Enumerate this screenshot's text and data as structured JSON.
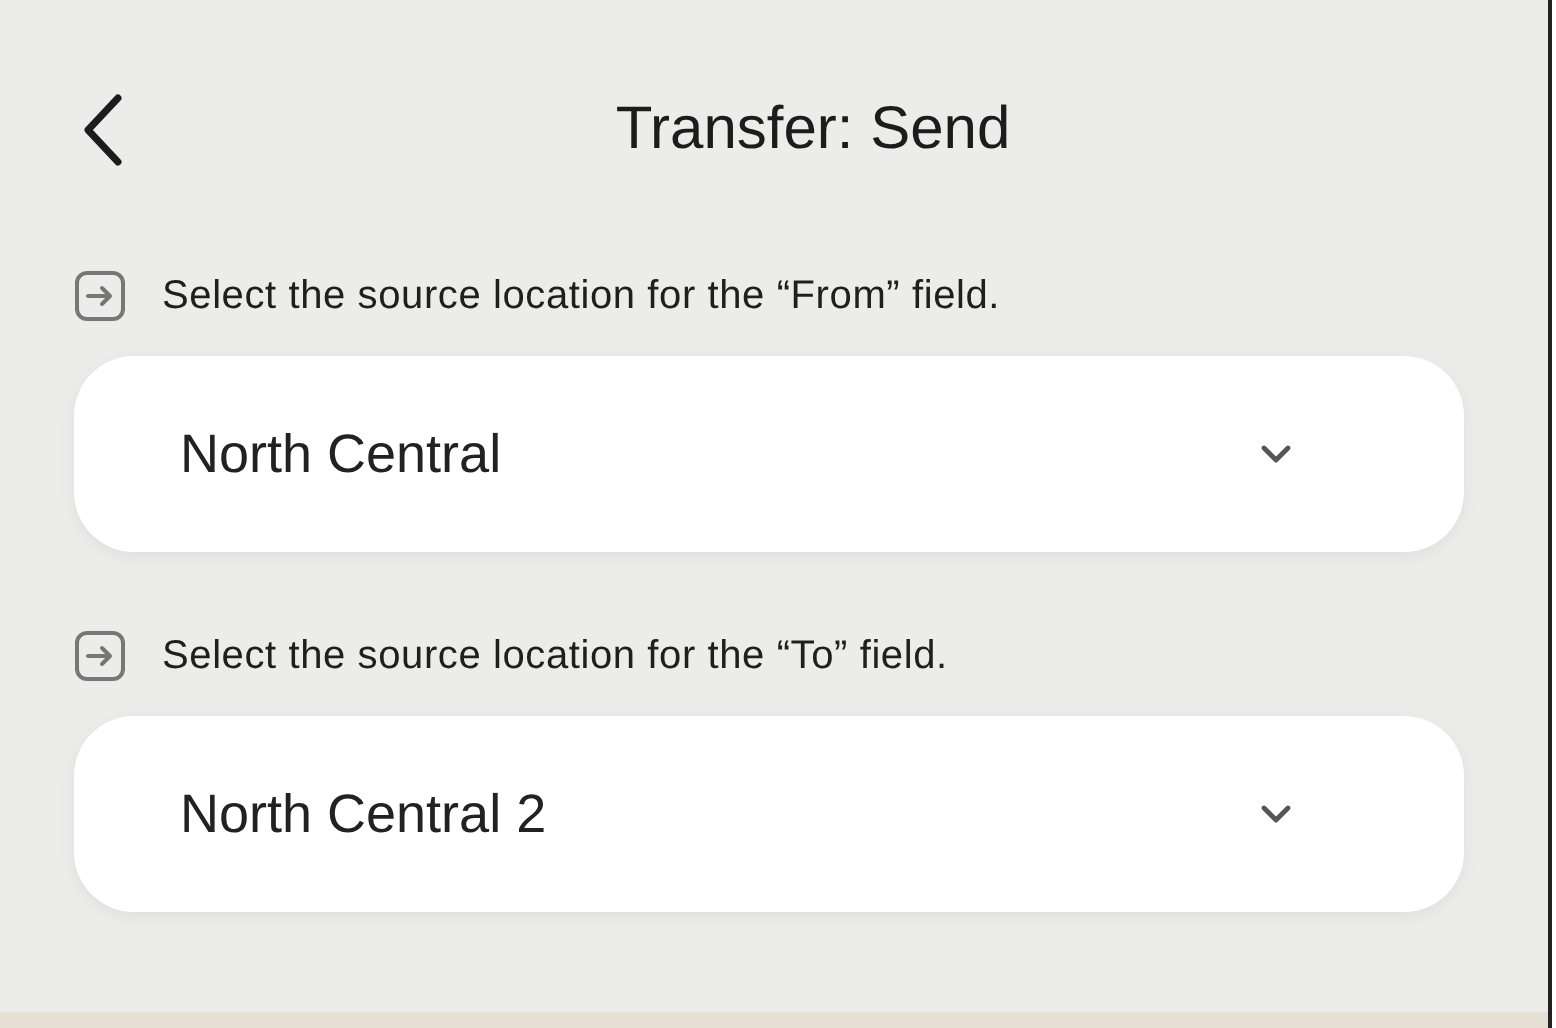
{
  "header": {
    "title": "Transfer: Send"
  },
  "fields": [
    {
      "hint": "Select the source location for the “From” field.",
      "value": "North Central"
    },
    {
      "hint": "Select the source location for the “To” field.",
      "value": "North Central 2"
    }
  ]
}
